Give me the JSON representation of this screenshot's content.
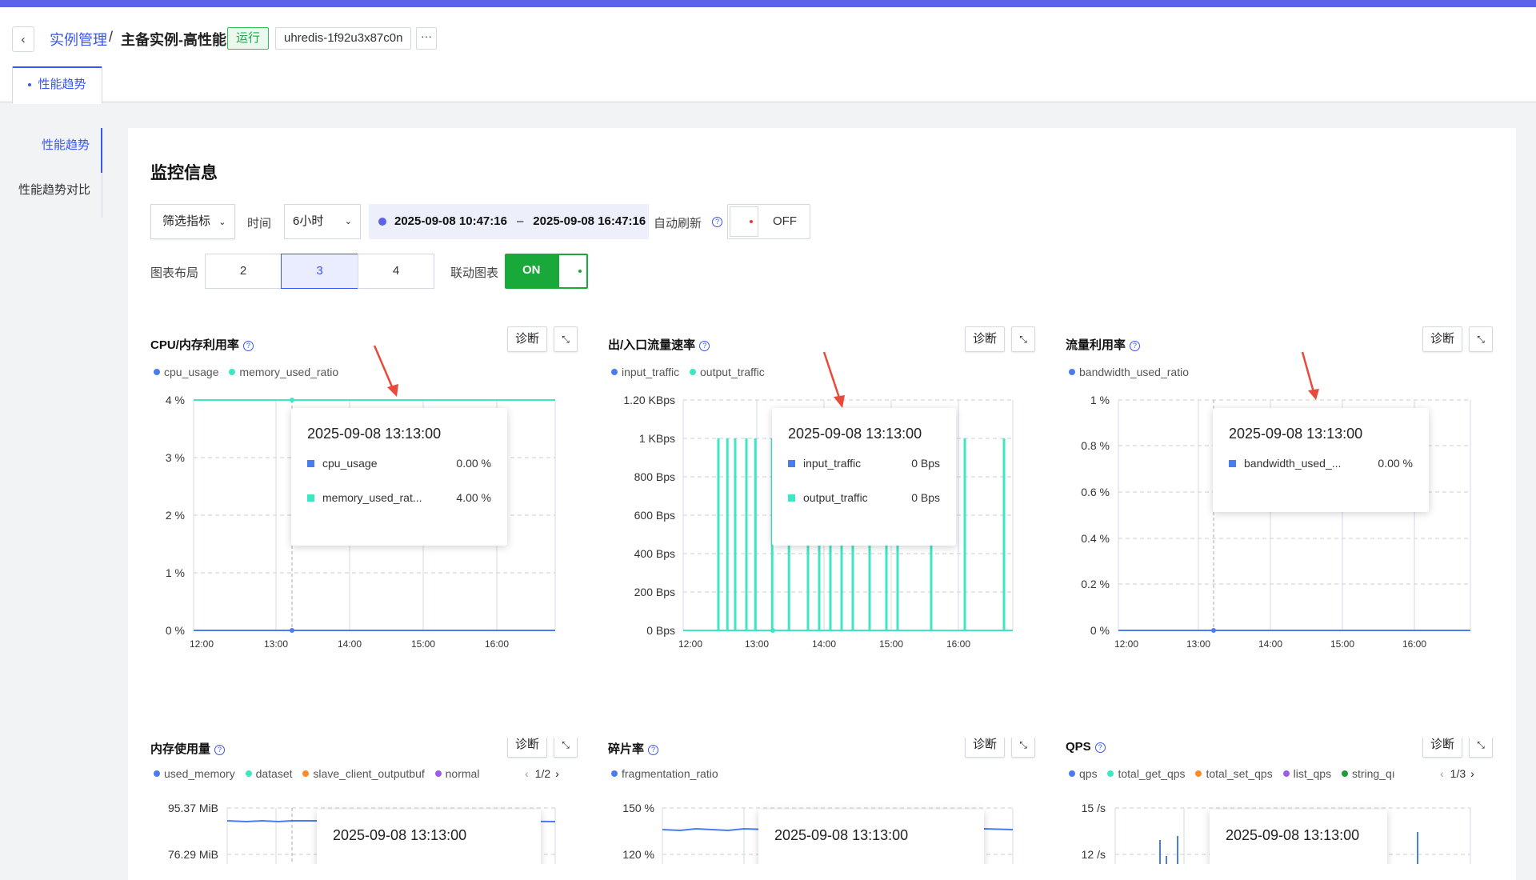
{
  "header": {
    "back_icon": "‹",
    "breadcrumb_parent": "实例管理",
    "breadcrumb_sep": "/",
    "breadcrumb_current": "主备实例-高性能",
    "status": "运行",
    "instance_id": "uhredis-1f92u3x87c0n",
    "more": "···"
  },
  "tabs": [
    {
      "label": "性能趋势"
    }
  ],
  "sidebar": {
    "items": [
      {
        "label": "性能趋势",
        "active": true
      },
      {
        "label": "性能趋势对比",
        "active": false
      }
    ]
  },
  "section_title": "监控信息",
  "controls": {
    "filter_label": "筛选指标",
    "time_label": "时间",
    "time_value": "6小时",
    "range_start": "2025-09-08 10:47:16",
    "range_sep": "–",
    "range_end": "2025-09-08 16:47:16",
    "auto_refresh_label": "自动刷新",
    "auto_refresh_state": "OFF",
    "layout_label": "图表布局",
    "layout_options": [
      "2",
      "3",
      "4"
    ],
    "layout_selected": "3",
    "link_label": "联动图表",
    "link_state": "ON"
  },
  "colors": {
    "accent": "#3a55f0",
    "series_blue": "#4a7cf0",
    "series_teal": "#3ee6c4",
    "orange": "#ff8a2a",
    "purple": "#9b5de5",
    "green": "#1a9e3a",
    "on_green": "#19a83a",
    "arrow_red": "#e84a3b"
  },
  "panels": [
    {
      "title": "CPU/内存利用率",
      "diag": "诊断",
      "expand_icon": "expand-icon",
      "legend": [
        {
          "name": "cpu_usage",
          "color": "#4a7cf0"
        },
        {
          "name": "memory_used_ratio",
          "color": "#3ee6c4"
        }
      ],
      "tooltip": {
        "time": "2025-09-08 13:13:00",
        "rows": [
          {
            "name": "cpu_usage",
            "value": "0.00 %",
            "color": "#4a7cf0"
          },
          {
            "name": "memory_used_rat...",
            "value": "4.00 %",
            "color": "#3ee6c4"
          }
        ]
      }
    },
    {
      "title": "出/入口流量速率",
      "diag": "诊断",
      "expand_icon": "expand-icon",
      "legend": [
        {
          "name": "input_traffic",
          "color": "#4a7cf0"
        },
        {
          "name": "output_traffic",
          "color": "#3ee6c4"
        }
      ],
      "tooltip": {
        "time": "2025-09-08 13:13:00",
        "rows": [
          {
            "name": "input_traffic",
            "value": "0 Bps",
            "color": "#4a7cf0"
          },
          {
            "name": "output_traffic",
            "value": "0 Bps",
            "color": "#3ee6c4"
          }
        ]
      }
    },
    {
      "title": "流量利用率",
      "diag": "诊断",
      "expand_icon": "expand-icon",
      "legend": [
        {
          "name": "bandwidth_used_ratio",
          "color": "#4a7cf0"
        }
      ],
      "tooltip": {
        "time": "2025-09-08 13:13:00",
        "rows": [
          {
            "name": "bandwidth_used_...",
            "value": "0.00 %",
            "color": "#4a7cf0"
          }
        ]
      }
    },
    {
      "title": "内存使用量",
      "diag": "诊断",
      "expand_icon": "expand-icon",
      "legend": [
        {
          "name": "used_memory",
          "color": "#4a7cf0"
        },
        {
          "name": "dataset",
          "color": "#3ee6c4"
        },
        {
          "name": "slave_client_outputbuf",
          "color": "#ff8a2a"
        },
        {
          "name": "normal",
          "color": "#9b5de5"
        }
      ],
      "pager": "1/2",
      "tooltip": {
        "time": "2025-09-08 13:13:00",
        "rows": []
      }
    },
    {
      "title": "碎片率",
      "diag": "诊断",
      "expand_icon": "expand-icon",
      "legend": [
        {
          "name": "fragmentation_ratio",
          "color": "#4a7cf0"
        }
      ],
      "tooltip": {
        "time": "2025-09-08 13:13:00",
        "rows": []
      }
    },
    {
      "title": "QPS",
      "diag": "诊断",
      "expand_icon": "expand-icon",
      "legend": [
        {
          "name": "qps",
          "color": "#4a7cf0"
        },
        {
          "name": "total_get_qps",
          "color": "#3ee6c4"
        },
        {
          "name": "total_set_qps",
          "color": "#ff8a2a"
        },
        {
          "name": "list_qps",
          "color": "#9b5de5"
        },
        {
          "name": "string_qı",
          "color": "#1a9e3a"
        }
      ],
      "pager": "1/3",
      "tooltip": {
        "time": "2025-09-08 13:13:00",
        "rows": []
      }
    }
  ],
  "chart_data": [
    {
      "type": "line",
      "title": "CPU/内存利用率",
      "x_ticks": [
        "12:00",
        "13:00",
        "14:00",
        "15:00",
        "16:00"
      ],
      "y_ticks": [
        "4 %",
        "3 %",
        "2 %",
        "1 %",
        "0 %"
      ],
      "ylim": [
        0,
        4
      ],
      "series": [
        {
          "name": "cpu_usage",
          "values": [
            0,
            0,
            0,
            0,
            0,
            0,
            0
          ]
        },
        {
          "name": "memory_used_ratio",
          "values": [
            4,
            4,
            4,
            4,
            4,
            4,
            4
          ]
        }
      ]
    },
    {
      "type": "line",
      "title": "出/入口流量速率",
      "x_ticks": [
        "12:00",
        "13:00",
        "14:00",
        "15:00",
        "16:00"
      ],
      "y_ticks": [
        "1.20 KBps",
        "1 KBps",
        "800 Bps",
        "600 Bps",
        "400 Bps",
        "200 Bps",
        "0 Bps"
      ],
      "ylim": [
        0,
        1200
      ],
      "spikes_output_traffic": [
        {
          "t": "12:25",
          "v": 1000
        },
        {
          "t": "12:33",
          "v": 1000
        },
        {
          "t": "12:40",
          "v": 1000
        },
        {
          "t": "12:50",
          "v": 1000
        },
        {
          "t": "12:58",
          "v": 1000
        },
        {
          "t": "13:13",
          "v": 1000
        },
        {
          "t": "13:28",
          "v": 1000
        },
        {
          "t": "13:45",
          "v": 1000
        },
        {
          "t": "13:55",
          "v": 1000
        },
        {
          "t": "14:05",
          "v": 1000
        },
        {
          "t": "14:15",
          "v": 1000
        },
        {
          "t": "14:25",
          "v": 1000
        },
        {
          "t": "14:40",
          "v": 1000
        },
        {
          "t": "14:55",
          "v": 1000
        },
        {
          "t": "15:05",
          "v": 1000
        },
        {
          "t": "15:35",
          "v": 1000
        },
        {
          "t": "16:05",
          "v": 1000
        },
        {
          "t": "16:40",
          "v": 1000
        }
      ]
    },
    {
      "type": "line",
      "title": "流量利用率",
      "x_ticks": [
        "12:00",
        "13:00",
        "14:00",
        "15:00",
        "16:00"
      ],
      "y_ticks": [
        "1 %",
        "0.8 %",
        "0.6 %",
        "0.4 %",
        "0.2 %",
        "0 %"
      ],
      "ylim": [
        0,
        1
      ],
      "series": [
        {
          "name": "bandwidth_used_ratio",
          "values": [
            0,
            0,
            0,
            0,
            0,
            0,
            0
          ]
        }
      ]
    },
    {
      "type": "line",
      "title": "内存使用量",
      "y_ticks": [
        "95.37 MiB",
        "76.29 MiB"
      ]
    },
    {
      "type": "line",
      "title": "碎片率",
      "y_ticks": [
        "150 %",
        "120 %"
      ]
    },
    {
      "type": "line",
      "title": "QPS",
      "y_ticks": [
        "15 /s",
        "12 /s"
      ]
    }
  ]
}
